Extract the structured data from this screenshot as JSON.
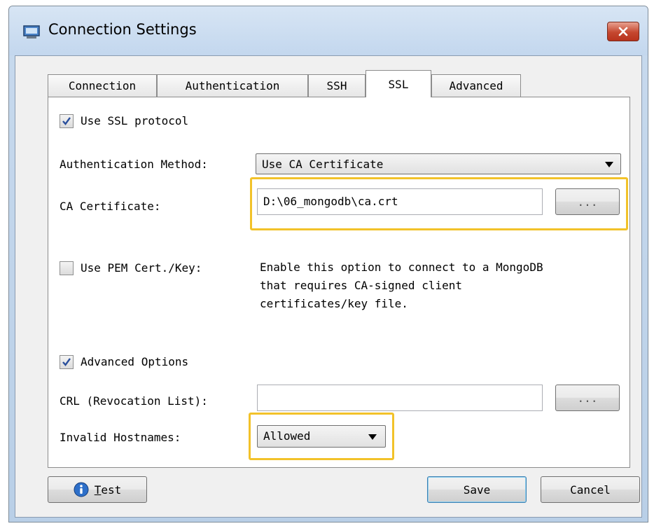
{
  "window": {
    "title": "Connection Settings",
    "icon": "monitor-icon",
    "close_icon": "close-icon"
  },
  "tabs": [
    {
      "label": "Connection",
      "active": false
    },
    {
      "label": "Authentication",
      "active": false
    },
    {
      "label": "SSH",
      "active": false
    },
    {
      "label": "SSL",
      "active": true
    },
    {
      "label": "Advanced",
      "active": false
    }
  ],
  "ssl": {
    "use_ssl": {
      "label": "Use SSL protocol",
      "checked": true
    },
    "auth_method": {
      "label": "Authentication Method:",
      "value": "Use CA Certificate"
    },
    "ca_certificate": {
      "label": "CA Certificate:",
      "value": "D:\\06_mongodb\\ca.crt",
      "browse_label": "..."
    },
    "use_pem": {
      "label": "Use PEM Cert./Key:",
      "checked": false
    },
    "pem_description": [
      "Enable this option to connect to a MongoDB",
      "that requires CA-signed client",
      "certificates/key file."
    ],
    "advanced_options": {
      "label": "Advanced Options",
      "checked": true
    },
    "crl": {
      "label": "CRL (Revocation List):",
      "value": "",
      "browse_label": "..."
    },
    "invalid_hostnames": {
      "label": "Invalid Hostnames:",
      "value": "Allowed"
    }
  },
  "footer": {
    "test_label": "Test",
    "save_label": "Save",
    "cancel_label": "Cancel"
  },
  "colors": {
    "highlight": "#f2c22a",
    "close_button": "#c5472f",
    "info_icon": "#2d6fc9"
  }
}
